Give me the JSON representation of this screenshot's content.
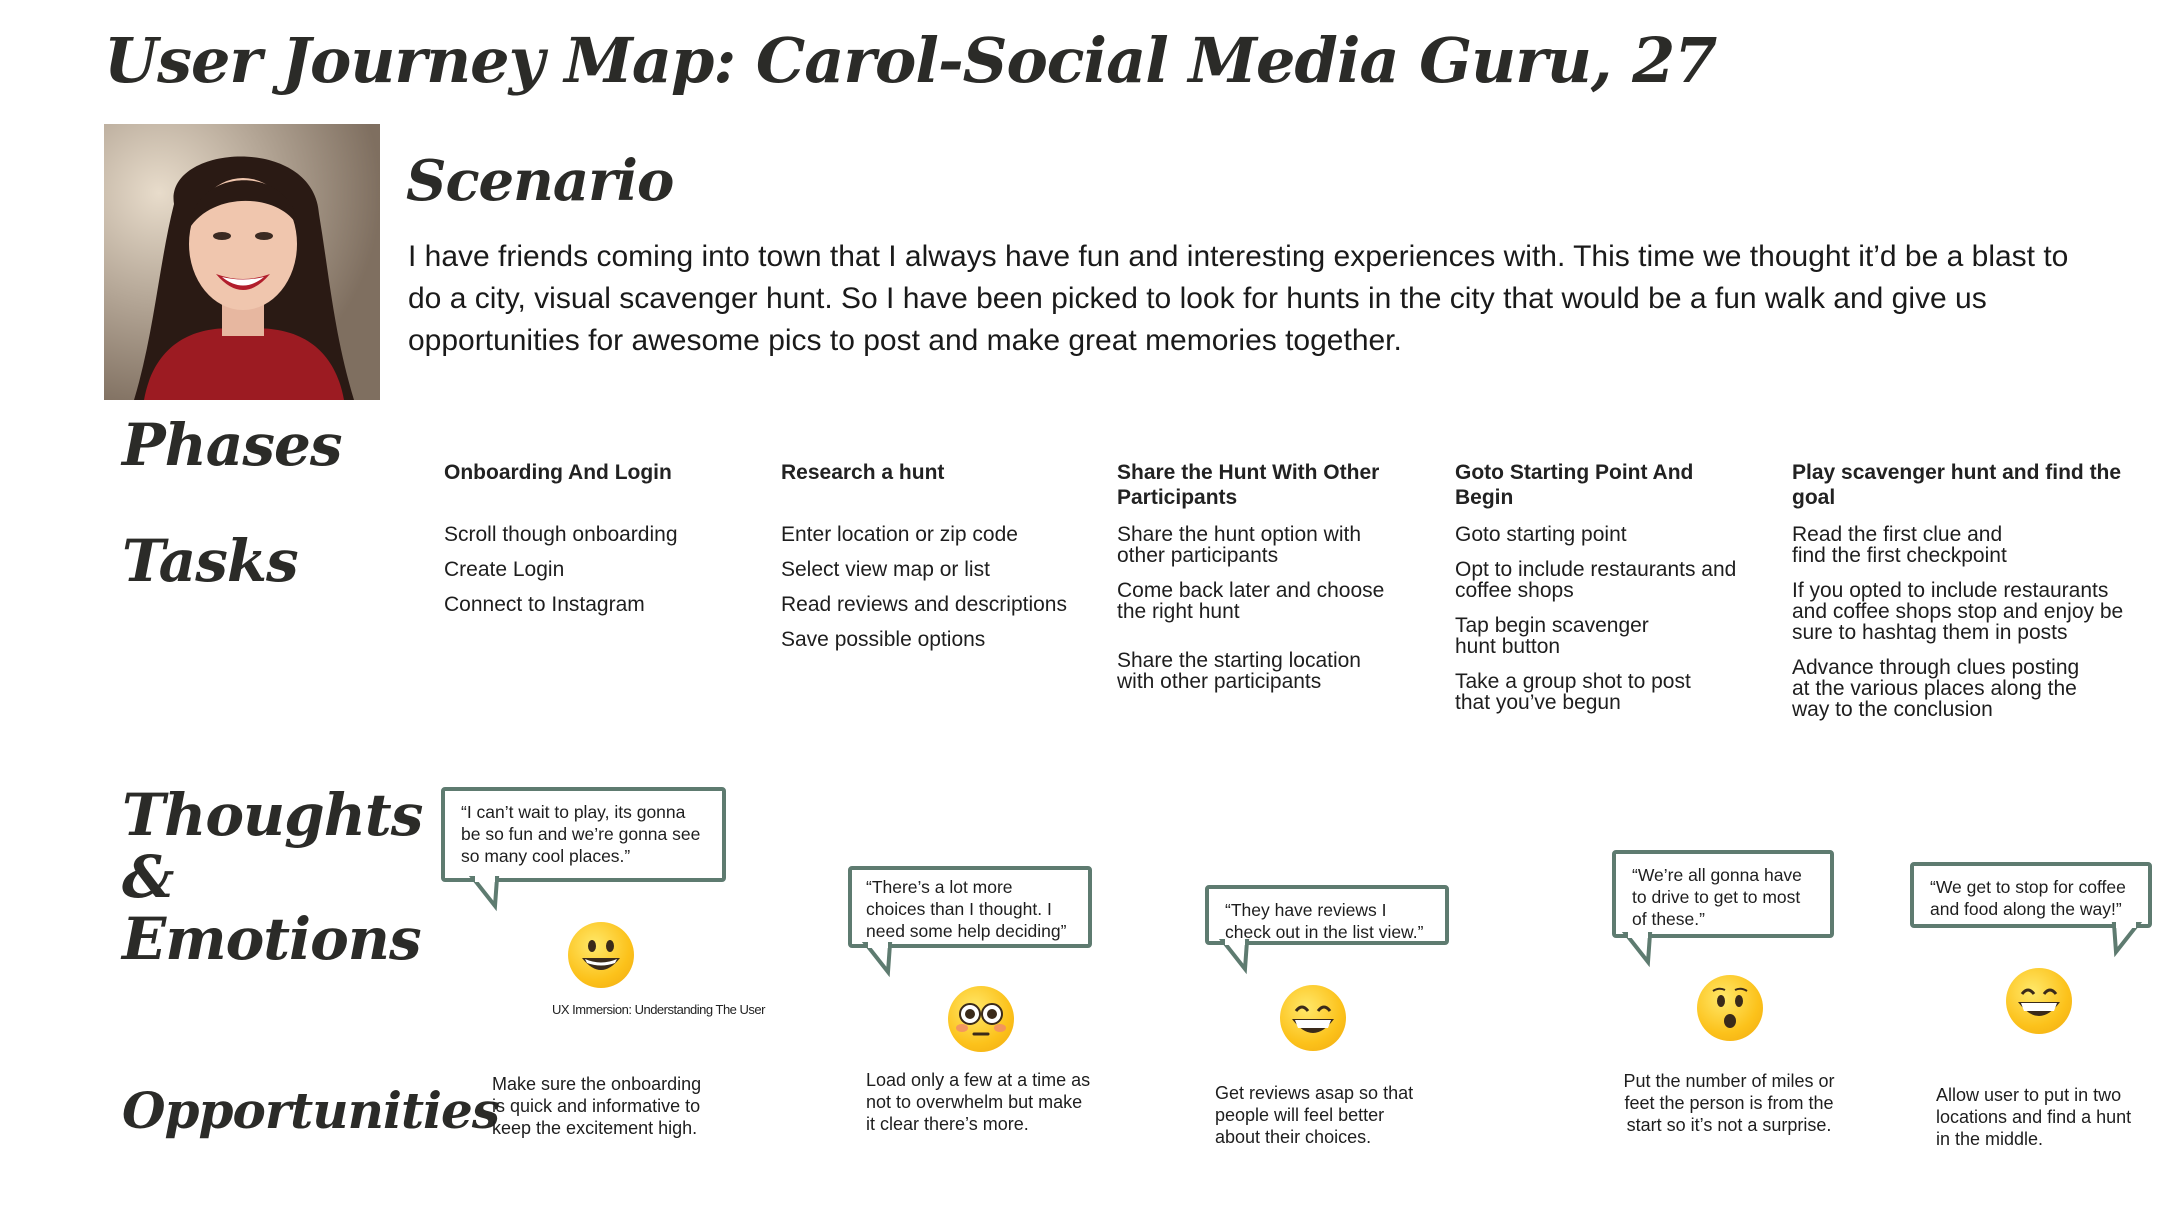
{
  "title": "User Journey Map: Carol-Social Media Guru, 27",
  "scenario": {
    "heading": "Scenario",
    "text": "I have friends coming into town that I always have fun and interesting experiences with. This time we thought it’d be a blast to do a city, visual scavenger hunt. So I have been picked to look for hunts in the city that would be a fun walk and give us opportunities for awesome pics to post and make great memories together."
  },
  "labels": {
    "phases": "Phases",
    "tasks": "Tasks",
    "thoughts_line1": "Thoughts",
    "thoughts_line2": "&",
    "thoughts_line3": "Emotions",
    "opportunities": "Opportunities"
  },
  "columns": [
    {
      "phase": "Onboarding And Login",
      "tasks": [
        "Scroll though onboarding",
        "Create Login",
        "Connect to Instagram"
      ],
      "thought": "“I can’t wait to play, its gonna be so fun and we’re gonna see so many cool places.”",
      "emotion_icon": "grinning-face-icon",
      "opportunity": "Make sure the onboarding is quick and informative to keep the excitement high."
    },
    {
      "phase": "Research a hunt",
      "tasks": [
        "Enter location or zip code",
        "Select view map or list",
        "Read reviews and descriptions",
        "Save possible options"
      ],
      "thought": "“There’s a lot more choices than I thought. I need some help deciding”",
      "emotion_icon": "flushed-face-icon",
      "opportunity": "Load only a few at a time as not to overwhelm but make it clear there’s more."
    },
    {
      "phase": "Share the Hunt With Other Participants",
      "tasks": [
        "Share the hunt option with other participants",
        "Come back later and choose the right hunt",
        "Share the starting location with other participants"
      ],
      "thought": "“They have reviews I check out in the list view.”",
      "emotion_icon": "beaming-face-icon",
      "opportunity": "Get reviews asap so that people will feel better about their choices."
    },
    {
      "phase": "Goto Starting Point And Begin",
      "tasks": [
        "Goto starting point",
        "Opt to include restaurants and coffee shops",
        "Tap begin scavenger hunt button",
        "Take a group shot to post that you’ve begun"
      ],
      "thought": "“We’re all gonna have to drive to get to most of these.”",
      "emotion_icon": "hushed-face-icon",
      "opportunity": "Put the number of miles or feet the person is from the start so it’s not a surprise."
    },
    {
      "phase": "Play scavenger hunt and find the goal",
      "tasks": [
        "Read the first clue and find the first checkpoint",
        "If you opted to include restaurants and coffee shops stop and enjoy be sure to hashtag them in posts",
        "Advance through clues posting at the various places along the way to the conclusion"
      ],
      "thought": "“We get to stop for coffee and food along the way!”",
      "emotion_icon": "beaming-face-icon",
      "opportunity": "Allow user to put in two locations and find a hunt in the middle."
    }
  ],
  "caption": "UX Immersion: Understanding The User",
  "colors": {
    "bubble_border": "#5e7b70",
    "emoji_yellow": "#fcc21b"
  }
}
